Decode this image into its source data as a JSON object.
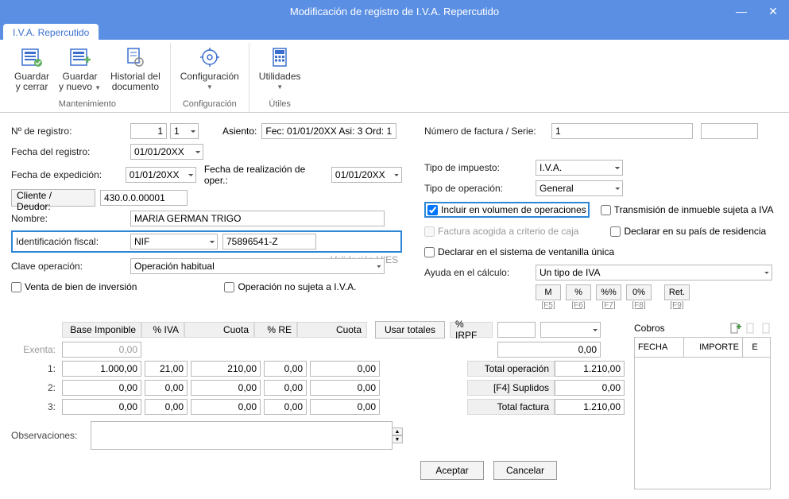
{
  "window": {
    "title": "Modificación de registro de I.V.A. Repercutido"
  },
  "tab": {
    "label": "I.V.A. Repercutido"
  },
  "ribbon": {
    "groups": [
      {
        "label": "Mantenimiento",
        "buttons": [
          {
            "name": "guardar-cerrar",
            "line1": "Guardar",
            "line2": "y cerrar"
          },
          {
            "name": "guardar-nuevo",
            "line1": "Guardar",
            "line2": "y nuevo",
            "caret": true
          },
          {
            "name": "historial",
            "line1": "Historial del",
            "line2": "documento"
          }
        ]
      },
      {
        "label": "Configuración",
        "buttons": [
          {
            "name": "configuracion",
            "line1": "Configuración",
            "line2": "",
            "caret": true
          }
        ]
      },
      {
        "label": "Útiles",
        "buttons": [
          {
            "name": "utilidades",
            "line1": "Utilidades",
            "line2": "",
            "caret": true
          }
        ]
      }
    ]
  },
  "left": {
    "n_registro_lbl": "Nº de registro:",
    "n_registro_a": "1",
    "n_registro_b": "1",
    "asiento_lbl": "Asiento:",
    "asiento_val": "Fec: 01/01/20XX Asi: 3 Ord: 1",
    "fecha_reg_lbl": "Fecha del registro:",
    "fecha_reg_val": "01/01/20XX",
    "fecha_exp_lbl": "Fecha de expedición:",
    "fecha_exp_val": "01/01/20XX",
    "fecha_oper_lbl": "Fecha de realización de oper.:",
    "fecha_oper_val": "01/01/20XX",
    "cliente_btn": "Cliente / Deudor:",
    "cliente_val": "430.0.0.00001",
    "nombre_lbl": "Nombre:",
    "nombre_val": "MARIA GERMAN TRIGO",
    "id_fiscal_lbl": "Identificación fiscal:",
    "id_fiscal_tipo": "NIF",
    "id_fiscal_num": "75896541-Z",
    "vies": "Validación VIES",
    "clave_lbl": "Clave operación:",
    "clave_val": "Operación habitual",
    "chk_venta": "Venta de bien de inversión",
    "chk_no_sujeta": "Operación no sujeta a I.V.A."
  },
  "right": {
    "num_fact_lbl": "Número de factura / Serie:",
    "num_fact_val": "1",
    "serie_val": "",
    "tipo_imp_lbl": "Tipo de impuesto:",
    "tipo_imp_val": "I.V.A.",
    "tipo_oper_lbl": "Tipo de operación:",
    "tipo_oper_val": "General",
    "chk_incluir": "Incluir en volumen de operaciones",
    "chk_trans": "Transmisión de inmueble sujeta a IVA",
    "chk_caja": "Factura acogida a criterio de caja",
    "chk_pais": "Declarar en su país de residencia",
    "chk_vent": "Declarar en el sistema de ventanilla única",
    "ayuda_lbl": "Ayuda en el cálculo:",
    "ayuda_val": "Un tipo de IVA",
    "mini": [
      "M",
      "%",
      "%%",
      "0%",
      "Ret."
    ],
    "mini_keys": [
      "[F5]",
      "[F6]",
      "[F7]",
      "[F8]",
      "[F9]"
    ]
  },
  "grid": {
    "headers": {
      "base": "Base Imponible",
      "piva": "% IVA",
      "cuota": "Cuota",
      "pre": "% RE",
      "cuota2": "Cuota",
      "usar": "Usar totales",
      "pirpf": "% IRPF"
    },
    "rows": [
      {
        "label": "Exenta:",
        "base": "0,00"
      },
      {
        "label": "1:",
        "base": "1.000,00",
        "piva": "21,00",
        "cuota": "210,00",
        "pre": "0,00",
        "cuota2": "0,00"
      },
      {
        "label": "2:",
        "base": "0,00",
        "piva": "0,00",
        "cuota": "0,00",
        "pre": "0,00",
        "cuota2": "0,00"
      },
      {
        "label": "3:",
        "base": "0,00",
        "piva": "0,00",
        "cuota": "0,00",
        "pre": "0,00",
        "cuota2": "0,00"
      }
    ],
    "irpf_base": "0,00",
    "totals": {
      "oper_lbl": "Total operación",
      "oper_val": "1.210,00",
      "supl_lbl": "[F4] Suplidos",
      "supl_val": "0,00",
      "fact_lbl": "Total factura",
      "fact_val": "1.210,00"
    },
    "obs_lbl": "Observaciones:"
  },
  "cobros": {
    "title": "Cobros",
    "cols": [
      "FECHA",
      "IMPORTE",
      "E"
    ]
  },
  "footer": {
    "ok": "Aceptar",
    "cancel": "Cancelar"
  }
}
